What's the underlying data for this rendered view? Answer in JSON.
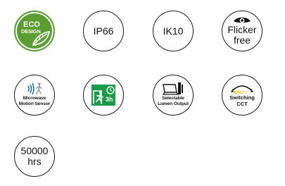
{
  "badges": {
    "eco": {
      "line1": "ECO",
      "line2": "DESIGN",
      "color": "#5a9e32",
      "icon": "leaf-icon"
    },
    "ip": {
      "label": "IP66"
    },
    "ik": {
      "label": "IK10"
    },
    "flicker": {
      "line1": "Flicker",
      "line2": "free",
      "icon": "eye-icon"
    },
    "microwave": {
      "line1": "Microwave",
      "line2": "Motion Sensor",
      "icon": "motion-sensor-icon",
      "accent": "#1f6fb8"
    },
    "emergency": {
      "label": "3h",
      "icon": "emergency-exit-icon",
      "color": "#1a9a4a"
    },
    "lumen": {
      "line1": "Selectable",
      "line2": "Lumen Output",
      "icon": "lumen-selector-icon"
    },
    "cct": {
      "line1": "Switching",
      "line2": "CCT",
      "icon": "cct-switch-icon",
      "accent": "#f2d23a"
    },
    "hours": {
      "line1": "50000",
      "line2": "hrs"
    }
  }
}
